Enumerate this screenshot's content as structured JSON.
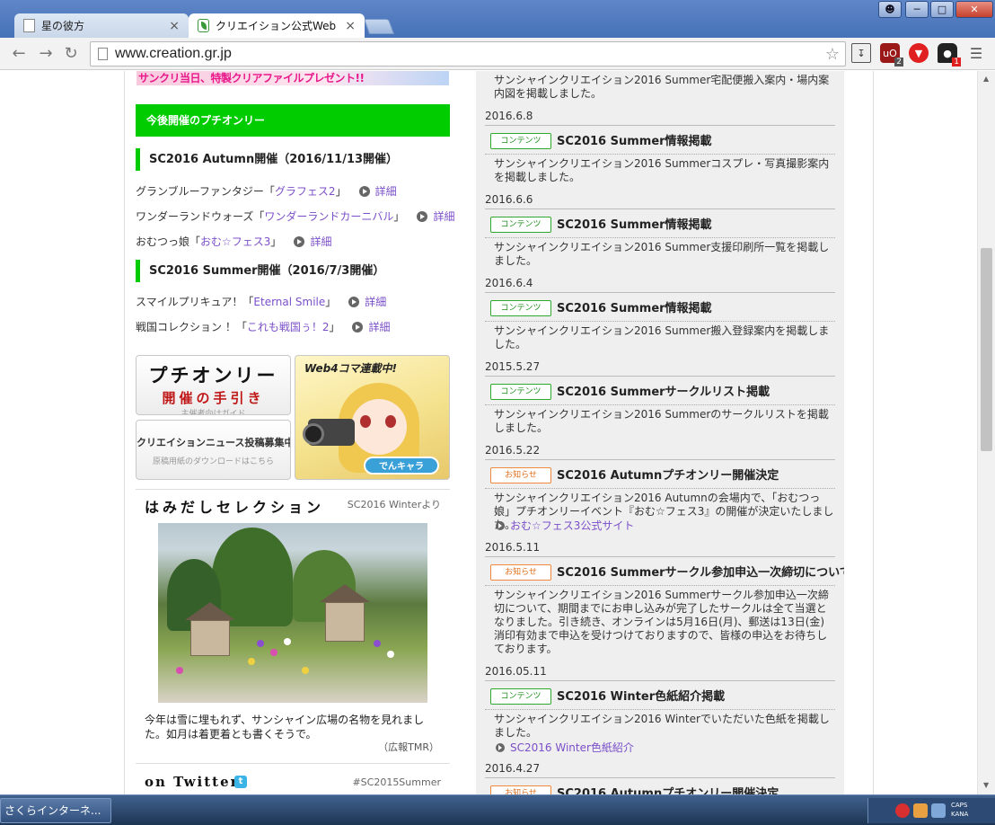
{
  "browser": {
    "tabs": [
      {
        "label": "星の彼方",
        "active": false
      },
      {
        "label": "クリエイション公式Web",
        "active": true
      }
    ],
    "url": "www.creation.gr.jp",
    "extensions": [
      {
        "icon": "download-icon",
        "badge": ""
      },
      {
        "icon": "ublock-icon",
        "badge": "2"
      },
      {
        "icon": "vivaldi-icon",
        "badge": ""
      },
      {
        "icon": "ghost-extension-icon",
        "badge": "1"
      },
      {
        "icon": "menu-icon",
        "badge": ""
      }
    ]
  },
  "left": {
    "banner_text": "サンクリ当日、特製クリアファイルプレゼント!!",
    "section_title": "今後開催のプチオンリー",
    "groups": [
      {
        "heading": "SC2016 Autumn開催（2016/11/13開催）",
        "items": [
          {
            "prefix": "グランブルーファンタジー「",
            "link": "グラフェス2",
            "suffix": "」",
            "detail": "詳細"
          },
          {
            "prefix": "ワンダーランドウォーズ「",
            "link": "ワンダーランドカーニバル",
            "suffix": "」",
            "detail": "詳細"
          },
          {
            "prefix": "おむつっ娘「",
            "link": "おむ☆フェス3",
            "suffix": "」",
            "detail": "詳細"
          }
        ]
      },
      {
        "heading": "SC2016 Summer開催（2016/7/3開催）",
        "items": [
          {
            "prefix": "スマイルプリキュア！「",
            "link": "Eternal Smile",
            "suffix": "」",
            "detail": "詳細"
          },
          {
            "prefix": "戦国コレクション ！「",
            "link": "これも戦国ぅ！2",
            "suffix": "」",
            "detail": "詳細"
          }
        ]
      }
    ],
    "cards": {
      "guide_title": "プチオンリー",
      "guide_sub": "開催の手引き",
      "guide_note": "主催者向けガイド",
      "news_title": "クリエイションニュース投稿募集中",
      "news_note": "原稿用紙のダウンロードはこちら",
      "manga_title": "Web4コマ連載中!",
      "manga_logo": "でんキャラ"
    },
    "selection": {
      "title": "はみだしセレクション",
      "source": "SC2016 Winterより",
      "caption": "今年は雪に埋もれず、サンシャイン広場の名物を見れました。如月は着更着とも書くそうで。",
      "credit": "（広報TMR）"
    },
    "twitter": {
      "title": "on Twitter",
      "hashtag": "#SC2015Summer"
    }
  },
  "news": {
    "top_text": "サンシャインクリエイション2016 Summer宅配便搬入案内・場内案内図を掲載しました。",
    "items": [
      {
        "date": "2016.6.8",
        "badge": "コンテンツ",
        "badge_color": "green",
        "title": "SC2016 Summer情報掲載",
        "text": "サンシャインクリエイション2016 Summerコスプレ・写真撮影案内を掲載しました。",
        "link": ""
      },
      {
        "date": "2016.6.6",
        "badge": "コンテンツ",
        "badge_color": "green",
        "title": "SC2016 Summer情報掲載",
        "text": "サンシャインクリエイション2016 Summer支援印刷所一覧を掲載しました。",
        "link": ""
      },
      {
        "date": "2016.6.4",
        "badge": "コンテンツ",
        "badge_color": "green",
        "title": "SC2016 Summer情報掲載",
        "text": "サンシャインクリエイション2016 Summer搬入登録案内を掲載しました。",
        "link": ""
      },
      {
        "date": "2015.5.27",
        "badge": "コンテンツ",
        "badge_color": "green",
        "title": "SC2016 Summerサークルリスト掲載",
        "text": "サンシャインクリエイション2016 Summerのサークルリストを掲載しました。",
        "link": ""
      },
      {
        "date": "2016.5.22",
        "badge": "お知らせ",
        "badge_color": "orange",
        "title": "SC2016 Autumnプチオンリー開催決定",
        "text": "サンシャインクリエイション2016 Autumnの会場内で、「おむつっ娘」プチオンリーイベント『おむ☆フェス3』の開催が決定いたしました。",
        "link": "おむ☆フェス3公式サイト"
      },
      {
        "date": "2016.5.11",
        "badge": "お知らせ",
        "badge_color": "orange",
        "title": "SC2016 Summerサークル参加申込一次締切について",
        "text": "サンシャインクリエイション2016 Summerサークル参加申込一次締切について、期間までにお申し込みが完了したサークルは全て当選となりました。引き続き、オンラインは5月16日(月)、郵送は13日(金)消印有効まで申込を受けつけておりますので、皆様の申込をお待ちしております。",
        "link": ""
      },
      {
        "date": "2016.05.11",
        "badge": "コンテンツ",
        "badge_color": "green",
        "title": "SC2016 Winter色紙紹介掲載",
        "text": "サンシャインクリエイション2016 Winterでいただいた色紙を掲載しました。",
        "link": "SC2016 Winter色紙紹介"
      },
      {
        "date": "2016.4.27",
        "badge": "お知らせ",
        "badge_color": "orange",
        "title": "SC2016 Autumnプチオンリー開催決定",
        "text": "",
        "link": ""
      }
    ]
  },
  "taskbar": {
    "item_label": "さくらインターネ...",
    "caps": "CAPS",
    "kana": "KANA"
  }
}
